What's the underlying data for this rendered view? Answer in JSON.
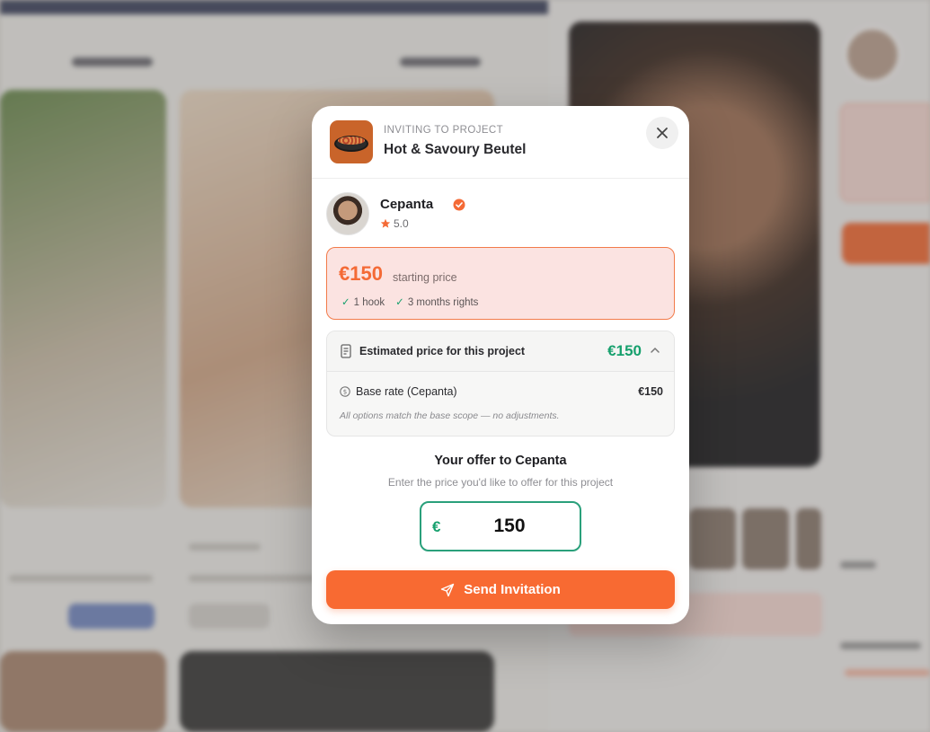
{
  "modal": {
    "inviting_label": "INVITING TO PROJECT",
    "project_name": "Hot & Savoury Beutel",
    "close_icon": "close-icon"
  },
  "creator": {
    "name": "Cepanta",
    "rating": "5.0",
    "verified_icon": "verified-badge-icon"
  },
  "price_card": {
    "amount": "€150",
    "note": "starting price",
    "features": [
      "1 hook",
      "3 months rights"
    ]
  },
  "estimate": {
    "title": "Estimated price for this project",
    "total": "€150",
    "rows": [
      {
        "label": "Base rate (Cepanta)",
        "value": "€150"
      }
    ],
    "note": "All options match the base scope — no adjustments."
  },
  "offer": {
    "title": "Your offer to Cepanta",
    "subtitle": "Enter the price you'd like to offer for this project",
    "currency": "€",
    "value": "150"
  },
  "send_button": {
    "label": "Send Invitation",
    "icon": "send-icon"
  },
  "colors": {
    "accent_orange": "#f86a32",
    "success_green": "#16a06d",
    "price_bg": "#fbe3e1"
  }
}
